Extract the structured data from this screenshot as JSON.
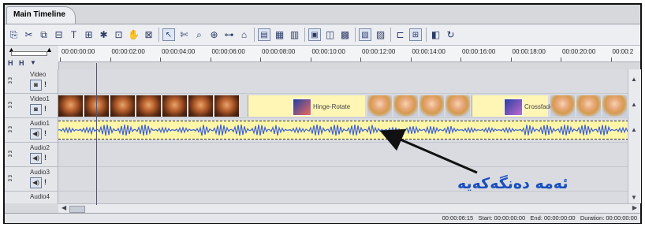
{
  "tab": {
    "title": "Main Timeline"
  },
  "toolbar": {
    "icons": [
      "text-icon",
      "scissor-icon",
      "split-icon",
      "trim-icon",
      "text-title-icon",
      "marker-icon",
      "effect-icon",
      "razor-icon",
      "grab-icon",
      "delete-icon",
      "pointer-icon",
      "scissors-cut-icon",
      "zoom-icon",
      "select-icon",
      "ripple-icon",
      "link-icon",
      "view-icon",
      "view2-icon",
      "view3-icon",
      "view4-icon",
      "view5-icon",
      "view6-icon",
      "view7-icon",
      "view8-icon",
      "snap-icon",
      "grid-icon",
      "flip-icon",
      "loop-icon"
    ]
  },
  "ruler": {
    "ticks": [
      "00:00:00:00",
      "00:00:02:00",
      "00:00:04:00",
      "00:00:06:00",
      "00:00:08:00",
      "00:00:10:00",
      "00:00:12:00",
      "00:00:14:00",
      "00:00:16:00",
      "00:00:18:00",
      "00:00:20:00",
      "00:00:2"
    ]
  },
  "tracks": [
    {
      "name": "Video",
      "type": "video-top"
    },
    {
      "name": "Video1",
      "type": "video"
    },
    {
      "name": "Audio1",
      "type": "audio"
    },
    {
      "name": "Audio2",
      "type": "audio-empty"
    },
    {
      "name": "Audio3",
      "type": "audio-empty"
    },
    {
      "name": "Audio4",
      "type": "audio-empty"
    }
  ],
  "transitions": [
    {
      "label": "Hinge-Rotate"
    },
    {
      "label": "Crossfade"
    }
  ],
  "status": {
    "position": "00:00:06:15",
    "start_label": "Start:",
    "start": "00:00:00:00",
    "end_label": "End:",
    "end": "00:00:00:00",
    "duration_label": "Duration:",
    "duration": "00:00:00:00"
  },
  "annotation": {
    "text": "ئەمە دەنگەکەیە"
  }
}
